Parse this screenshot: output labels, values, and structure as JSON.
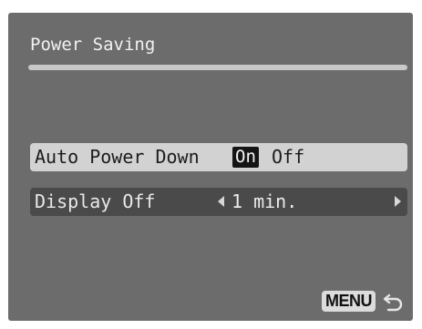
{
  "menu": {
    "title": "Power Saving"
  },
  "settings": [
    {
      "label": "Auto Power Down",
      "options": [
        "On",
        "Off"
      ],
      "selected": "On"
    },
    {
      "label": "Display Off",
      "value": "1 min."
    }
  ],
  "footer": {
    "menu_label": "MENU",
    "back_icon": "return-arrow-icon"
  },
  "colors": {
    "screen_bg": "#6c6c6c",
    "highlight_row": "#d2d2d2",
    "normal_row": "#4a4a4a",
    "selected_option_bg": "#141414"
  }
}
